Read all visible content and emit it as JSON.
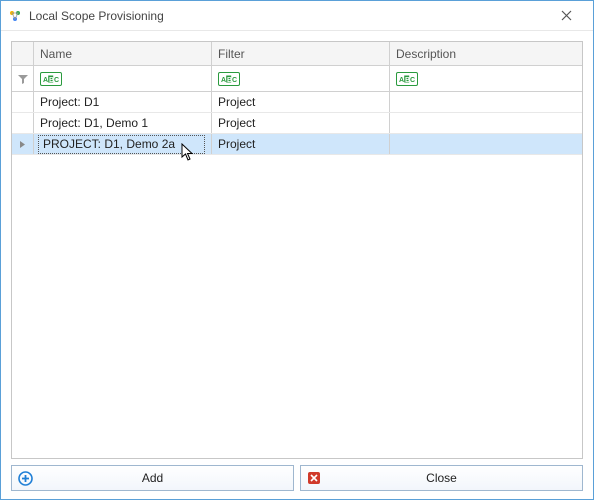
{
  "window": {
    "title": "Local Scope Provisioning"
  },
  "grid": {
    "headers": {
      "name": "Name",
      "filter": "Filter",
      "description": "Description"
    },
    "filter_row": {
      "name": "",
      "filter": "",
      "description": ""
    },
    "rows": [
      {
        "name": "Project: D1",
        "filter": "Project",
        "description": "",
        "selected": false
      },
      {
        "name": "Project: D1, Demo 1",
        "filter": "Project",
        "description": "",
        "selected": false
      },
      {
        "name": "PROJECT: D1, Demo 2a",
        "filter": "Project",
        "description": "",
        "selected": true
      }
    ]
  },
  "buttons": {
    "add": "Add",
    "close": "Close"
  },
  "icons": {
    "app": "scope-icon",
    "close_x": "close-icon",
    "filter_funnel": "funnel-icon",
    "filter_badge": "abc-icon",
    "row_indicator": "row-arrow-icon",
    "add": "plus-circle-icon",
    "cancel": "cancel-icon"
  },
  "colors": {
    "selection": "#cfe6fb",
    "border": "#c7c7c7",
    "window_border": "#5aa0d8",
    "badge_green": "#2a9a3e",
    "add_blue": "#1f7fd6",
    "cancel_red": "#d03a2a"
  }
}
